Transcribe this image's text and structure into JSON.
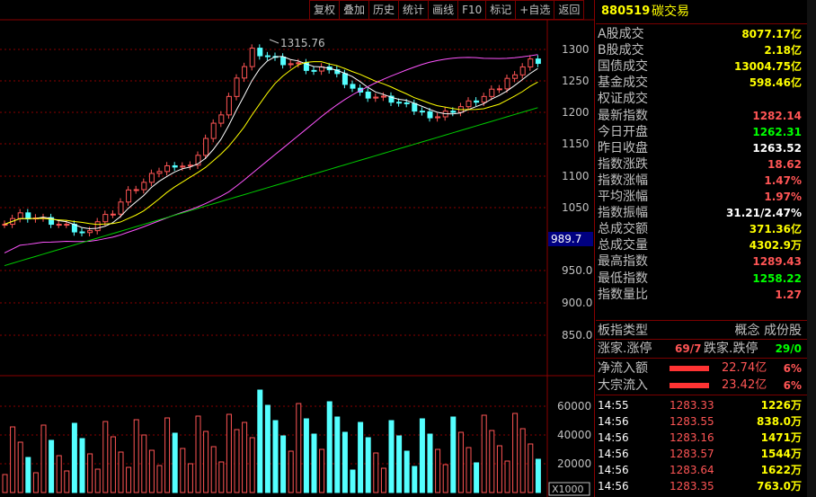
{
  "toolbar": [
    "复权",
    "叠加",
    "历史",
    "统计",
    "画线",
    "F10",
    "标记",
    "+自选",
    "返回"
  ],
  "chart": {
    "max_label": "1315.76",
    "price_ticks": [
      "1300",
      "1250",
      "1200",
      "1150",
      "1100",
      "1050",
      "950.0",
      "900.0",
      "850.0"
    ],
    "highlight_label": "989.7",
    "volume_ticks": [
      "60000",
      "40000",
      "20000"
    ],
    "unit_label": "X1000"
  },
  "chart_data": {
    "type": "line",
    "series": [
      {
        "values": [
          1030,
          1040,
          1035,
          1028,
          1020,
          1010,
          1030,
          1045,
          1075,
          1090,
          1110,
          1120,
          1115,
          1160,
          1200,
          1250,
          1300,
          1290,
          1280,
          1275,
          1265,
          1270,
          1250,
          1230,
          1225,
          1220,
          1210,
          1200,
          1195,
          1205,
          1215,
          1225,
          1240,
          1265,
          1282
        ]
      }
    ],
    "ylim": [
      850,
      1320
    ]
  },
  "panel": {
    "code": "880519",
    "name": "碳交易",
    "stats": [
      {
        "label": "A股成交",
        "value": "8077.17亿",
        "color": "#ffff00"
      },
      {
        "label": "B股成交",
        "value": "2.18亿",
        "color": "#ffff00"
      },
      {
        "label": "国债成交",
        "value": "13004.75亿",
        "color": "#ffff00"
      },
      {
        "label": "基金成交",
        "value": "598.46亿",
        "color": "#ffff00"
      },
      {
        "label": "权证成交",
        "value": "",
        "color": "#ffff00"
      },
      {
        "label": "最新指数",
        "value": "1282.14",
        "color": "#ff5555"
      },
      {
        "label": "今日开盘",
        "value": "1262.31",
        "color": "#00ff00"
      },
      {
        "label": "昨日收盘",
        "value": "1263.52",
        "color": "#ffffff"
      },
      {
        "label": "指数涨跌",
        "value": "18.62",
        "color": "#ff5555"
      },
      {
        "label": "指数涨幅",
        "value": "1.47%",
        "color": "#ff5555"
      },
      {
        "label": "平均涨幅",
        "value": "1.97%",
        "color": "#ff5555"
      },
      {
        "label": "指数振幅",
        "value": "31.21/2.47%",
        "color": "#ffffff"
      },
      {
        "label": "总成交额",
        "value": "371.36亿",
        "color": "#ffff00"
      },
      {
        "label": "总成交量",
        "value": "4302.9万",
        "color": "#ffff00"
      },
      {
        "label": "最高指数",
        "value": "1289.43",
        "color": "#ff5555"
      },
      {
        "label": "最低指数",
        "value": "1258.22",
        "color": "#00ff00"
      },
      {
        "label": "指数量比",
        "value": "1.27",
        "color": "#ff5555"
      }
    ],
    "type_row": {
      "label": "板指类型",
      "value": "概念 成份股"
    },
    "updown_row": {
      "label1": "涨家.涨停",
      "v1": "69/7",
      "label2": "跌家.跌停",
      "v2": "29/0"
    },
    "flow": [
      {
        "label": "净流入额",
        "value": "22.74亿",
        "pct": "6%"
      },
      {
        "label": "大宗流入",
        "value": "23.42亿",
        "pct": "6%"
      }
    ],
    "ticks": [
      {
        "time": "14:55",
        "price": "1283.33",
        "vol": "1226万"
      },
      {
        "time": "14:56",
        "price": "1283.55",
        "vol": "838.0万"
      },
      {
        "time": "14:56",
        "price": "1283.16",
        "vol": "1471万"
      },
      {
        "time": "14:56",
        "price": "1283.57",
        "vol": "1544万"
      },
      {
        "time": "14:56",
        "price": "1283.64",
        "vol": "1622万"
      },
      {
        "time": "14:56",
        "price": "1283.35",
        "vol": "763.0万"
      }
    ]
  }
}
